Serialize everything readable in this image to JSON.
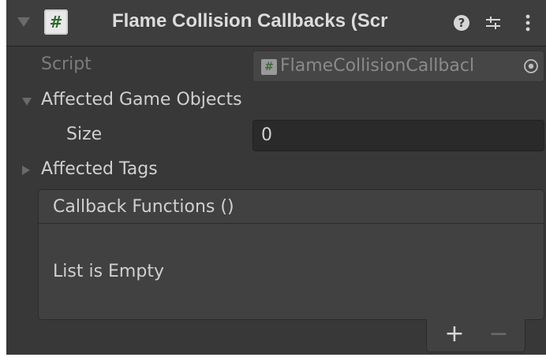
{
  "header": {
    "title": "Flame Collision Callbacks (Scr",
    "script_glyph": "#",
    "help_glyph": "?",
    "menu_glyph": "⋮"
  },
  "fields": {
    "script_label": "Script",
    "script_value": "FlameCollisionCallbacl",
    "affected_game_objects_label": "Affected Game Objects",
    "size_label": "Size",
    "size_value": "0",
    "affected_tags_label": "Affected Tags"
  },
  "callbacks": {
    "header": "Callback Functions ()",
    "empty_text": "List is Empty",
    "add_glyph": "+",
    "remove_glyph": "−"
  },
  "colors": {
    "panel_bg": "#383838",
    "header_bg": "#3e3e3e",
    "text": "#c4c4c4",
    "disabled_text": "#7c7c7c"
  },
  "icons": [
    "fold-arrow-icon",
    "script-icon",
    "help-icon",
    "preset-icon",
    "kebab-menu-icon",
    "target-icon",
    "foldout-arrow-icon"
  ]
}
